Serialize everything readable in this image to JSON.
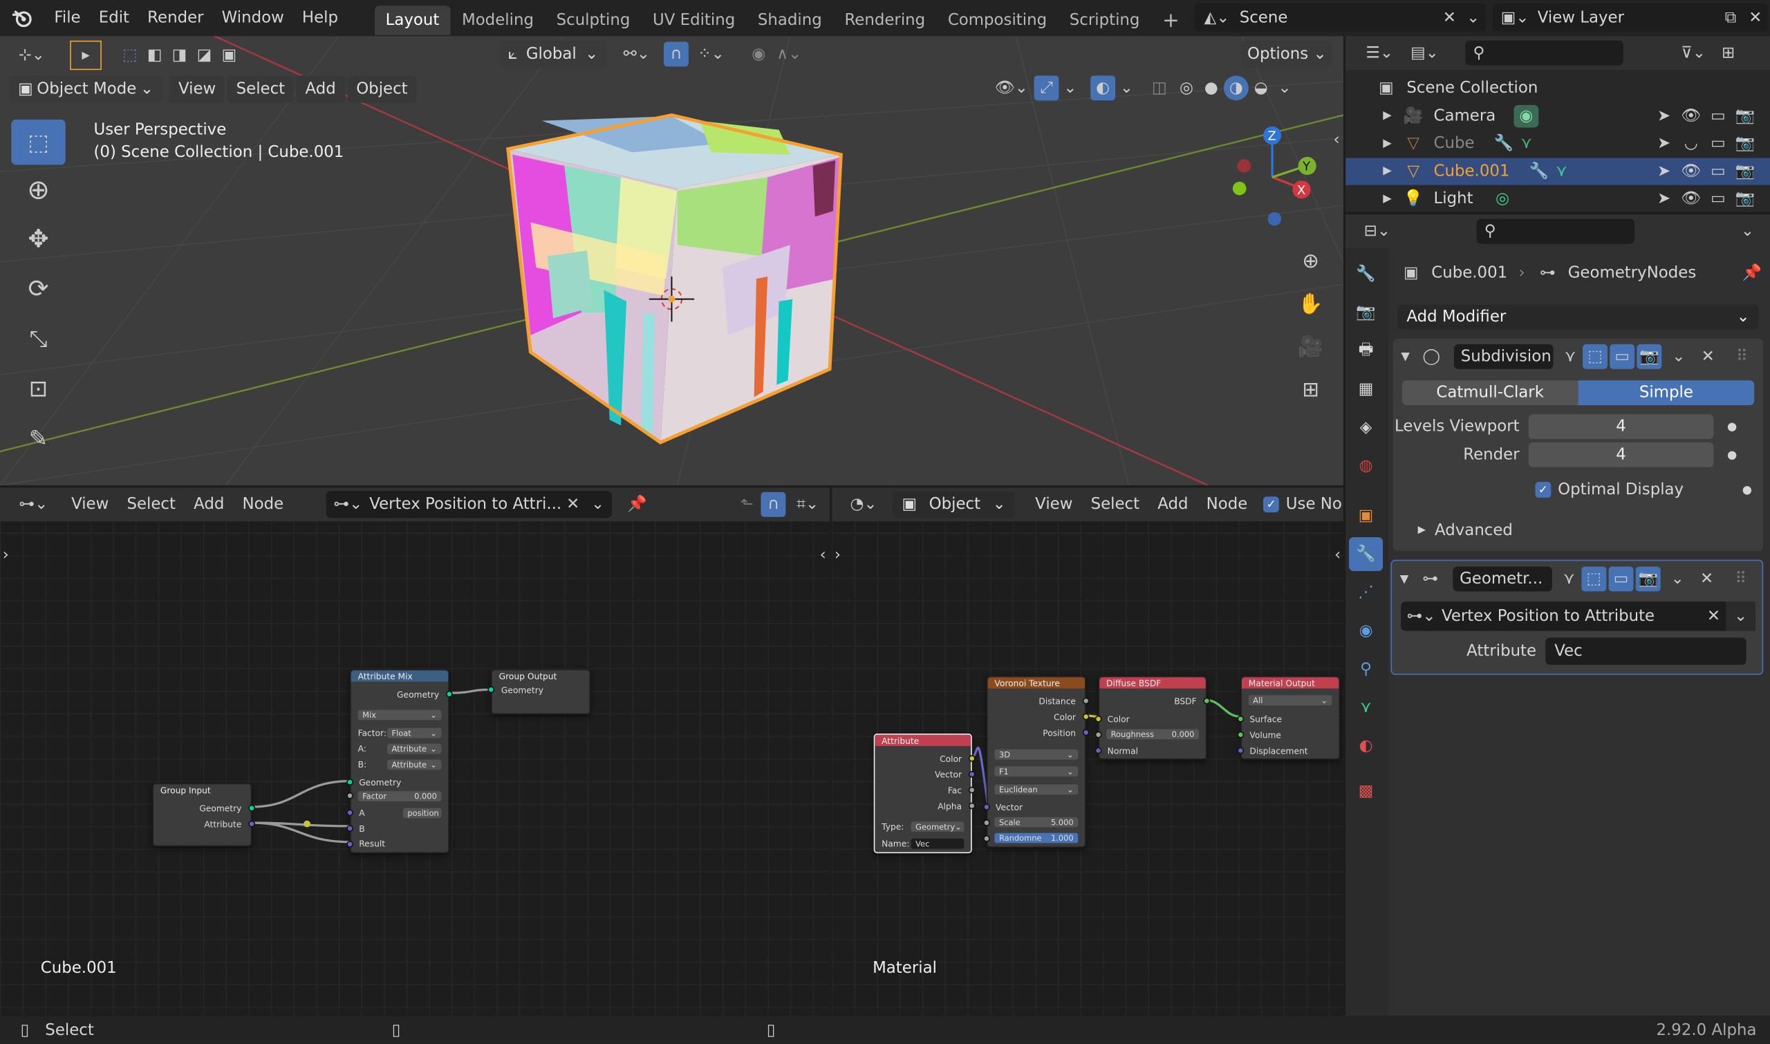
{
  "topbar": {
    "menus": [
      "File",
      "Edit",
      "Render",
      "Window",
      "Help"
    ],
    "workspaces": [
      "Layout",
      "Modeling",
      "Sculpting",
      "UV Editing",
      "Shading",
      "Rendering",
      "Compositing",
      "Scripting"
    ],
    "active_workspace": "Layout",
    "scene": "Scene",
    "view_layer": "View Layer"
  },
  "viewport": {
    "transform_orientation": "Global",
    "options_label": "Options",
    "mode": "Object Mode",
    "menus": [
      "View",
      "Select",
      "Add",
      "Object"
    ],
    "info_line1": "User Perspective",
    "info_line2": "(0) Scene Collection | Cube.001",
    "gizmo": {
      "x": "X",
      "y": "Y",
      "z": "Z"
    }
  },
  "geo_editor": {
    "menus": [
      "View",
      "Select",
      "Add",
      "Node"
    ],
    "node_tree": "Vertex Position to Attri...",
    "object_label": "Cube.001",
    "nodes": {
      "attr_mix": {
        "title": "Attribute Mix",
        "out_geometry": "Geometry",
        "blend": "Mix",
        "factor_label": "Factor:",
        "factor_type": "Float",
        "a_label": "A:",
        "a_type": "Attribute",
        "b_label": "B:",
        "b_type": "Attribute",
        "in_geometry": "Geometry",
        "factor_field": "Factor",
        "factor_value": "0.000",
        "a_in": "A",
        "a_value": "position",
        "b_in": "B",
        "result": "Result"
      },
      "group_output": {
        "title": "Group Output",
        "geometry": "Geometry"
      },
      "group_input": {
        "title": "Group Input",
        "geometry": "Geometry",
        "attribute": "Attribute"
      }
    }
  },
  "shader_editor": {
    "object_type": "Object",
    "menus": [
      "View",
      "Select",
      "Add",
      "Node"
    ],
    "use_nodes": "Use No",
    "label": "Material",
    "nodes": {
      "voronoi": {
        "title": "Voronoi Texture",
        "distance": "Distance",
        "color": "Color",
        "position": "Position",
        "dim": "3D",
        "feature": "F1",
        "metric": "Euclidean",
        "vector": "Vector",
        "scale_label": "Scale",
        "scale": "5.000",
        "rand_label": "Randomne",
        "rand": "1.000"
      },
      "diffuse": {
        "title": "Diffuse BSDF",
        "bsdf": "BSDF",
        "color": "Color",
        "rough_label": "Roughness",
        "rough": "0.000",
        "normal": "Normal"
      },
      "matout": {
        "title": "Material Output",
        "target": "All",
        "surface": "Surface",
        "volume": "Volume",
        "displacement": "Displacement"
      },
      "attribute": {
        "title": "Attribute",
        "color": "Color",
        "vector": "Vector",
        "fac": "Fac",
        "alpha": "Alpha",
        "type_label": "Type:",
        "type": "Geometry",
        "name_label": "Name:",
        "name": "Vec"
      }
    }
  },
  "outliner": {
    "root": "Scene Collection",
    "items": [
      {
        "name": "Camera",
        "selected": false
      },
      {
        "name": "Cube",
        "selected": false
      },
      {
        "name": "Cube.001",
        "selected": true
      },
      {
        "name": "Light",
        "selected": false
      }
    ]
  },
  "properties": {
    "object": "Cube.001",
    "modifier_tab": "GeometryNodes",
    "add_modifier": "Add Modifier",
    "subdivision": {
      "name": "Subdivision",
      "mode_a": "Catmull-Clark",
      "mode_b": "Simple",
      "levels_label": "Levels Viewport",
      "levels": "4",
      "render_label": "Render",
      "render": "4",
      "optimal_label": "Optimal Display",
      "advanced": "Advanced"
    },
    "geonodes": {
      "name": "Geometr...",
      "tree": "Vertex Position to Attribute",
      "attr_label": "Attribute",
      "attr_value": "Vec"
    }
  },
  "status": {
    "select": "Select",
    "version": "2.92.0 Alpha"
  },
  "colors": {
    "accent": "#4772b3",
    "selected_orange": "#f5a030",
    "header": "#303030"
  }
}
